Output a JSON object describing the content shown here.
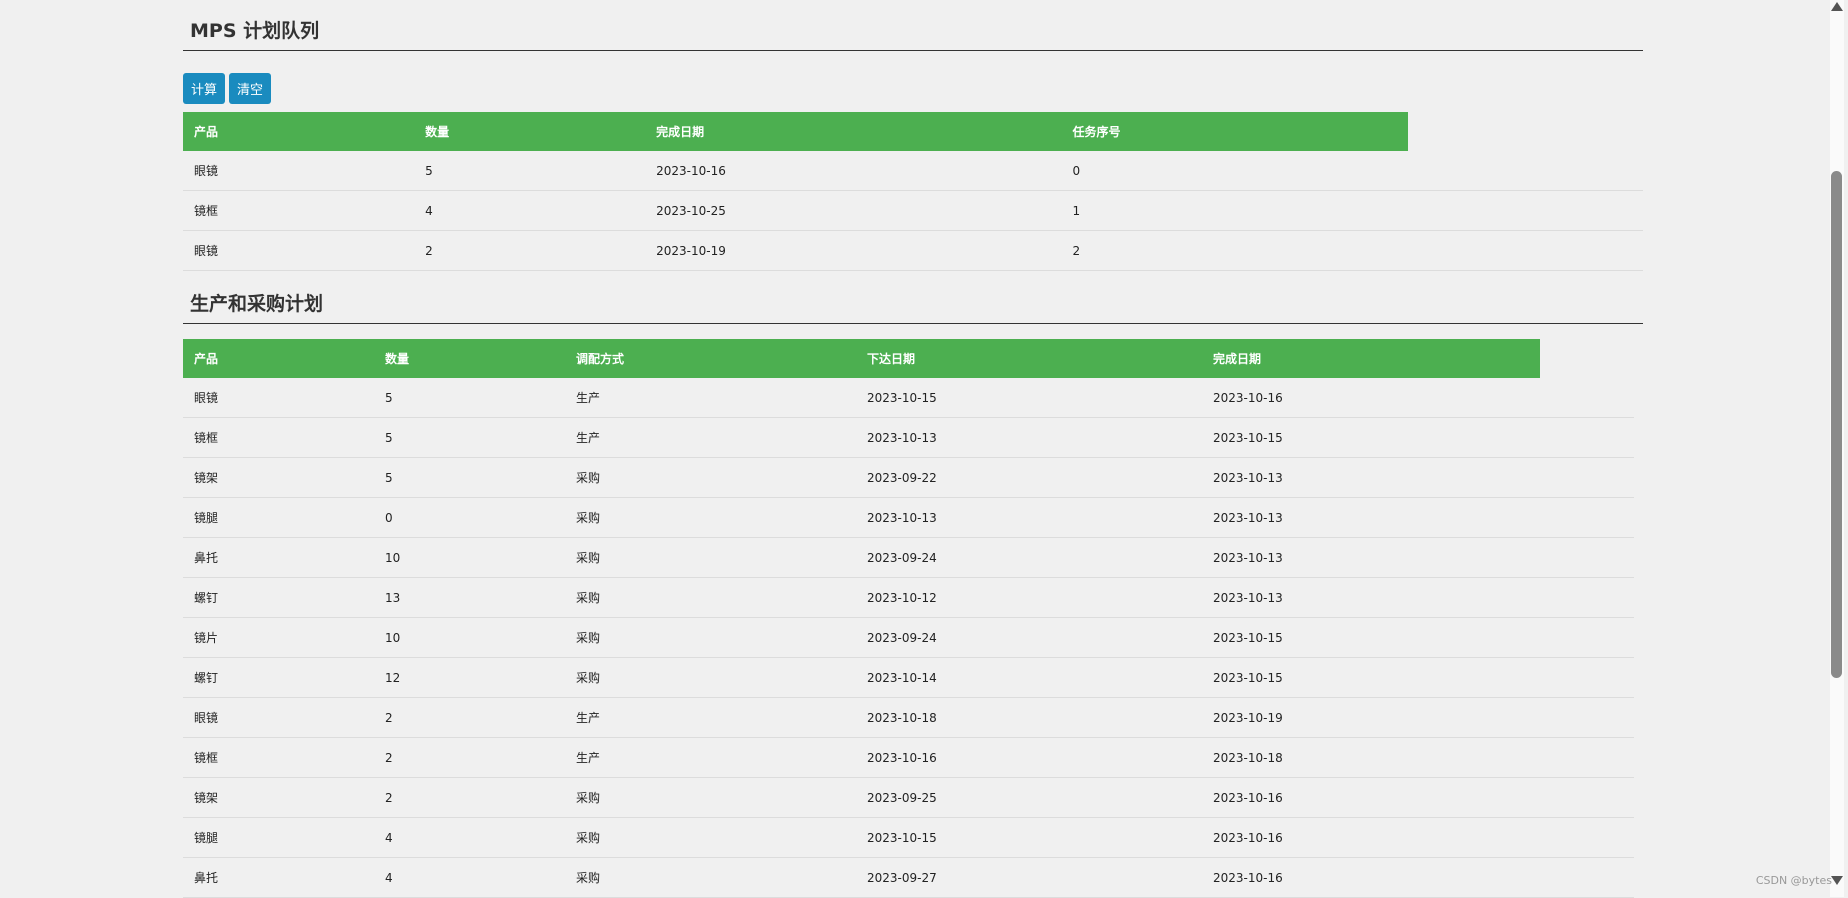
{
  "mps": {
    "title": "MPS 计划队列",
    "buttons": {
      "calc": "计算",
      "clear": "清空"
    },
    "columns": [
      "产品",
      "数量",
      "完成日期",
      "任务序号"
    ],
    "rows": [
      [
        "眼镜",
        "5",
        "2023-10-16",
        "0"
      ],
      [
        "镜框",
        "4",
        "2023-10-25",
        "1"
      ],
      [
        "眼镜",
        "2",
        "2023-10-19",
        "2"
      ]
    ]
  },
  "plan": {
    "title": "生产和采购计划",
    "columns": [
      "产品",
      "数量",
      "调配方式",
      "下达日期",
      "完成日期"
    ],
    "rows": [
      [
        "眼镜",
        "5",
        "生产",
        "2023-10-15",
        "2023-10-16"
      ],
      [
        "镜框",
        "5",
        "生产",
        "2023-10-13",
        "2023-10-15"
      ],
      [
        "镜架",
        "5",
        "采购",
        "2023-09-22",
        "2023-10-13"
      ],
      [
        "镜腿",
        "0",
        "采购",
        "2023-10-13",
        "2023-10-13"
      ],
      [
        "鼻托",
        "10",
        "采购",
        "2023-09-24",
        "2023-10-13"
      ],
      [
        "螺钉",
        "13",
        "采购",
        "2023-10-12",
        "2023-10-13"
      ],
      [
        "镜片",
        "10",
        "采购",
        "2023-09-24",
        "2023-10-15"
      ],
      [
        "螺钉",
        "12",
        "采购",
        "2023-10-14",
        "2023-10-15"
      ],
      [
        "眼镜",
        "2",
        "生产",
        "2023-10-18",
        "2023-10-19"
      ],
      [
        "镜框",
        "2",
        "生产",
        "2023-10-16",
        "2023-10-18"
      ],
      [
        "镜架",
        "2",
        "采购",
        "2023-09-25",
        "2023-10-16"
      ],
      [
        "镜腿",
        "4",
        "采购",
        "2023-10-15",
        "2023-10-16"
      ],
      [
        "鼻托",
        "4",
        "采购",
        "2023-09-27",
        "2023-10-16"
      ]
    ]
  },
  "watermark": "CSDN @bytes",
  "colors": {
    "header_bg": "#4caf50",
    "button_bg": "#1a8bbf",
    "page_bg": "#f0f0f0"
  }
}
